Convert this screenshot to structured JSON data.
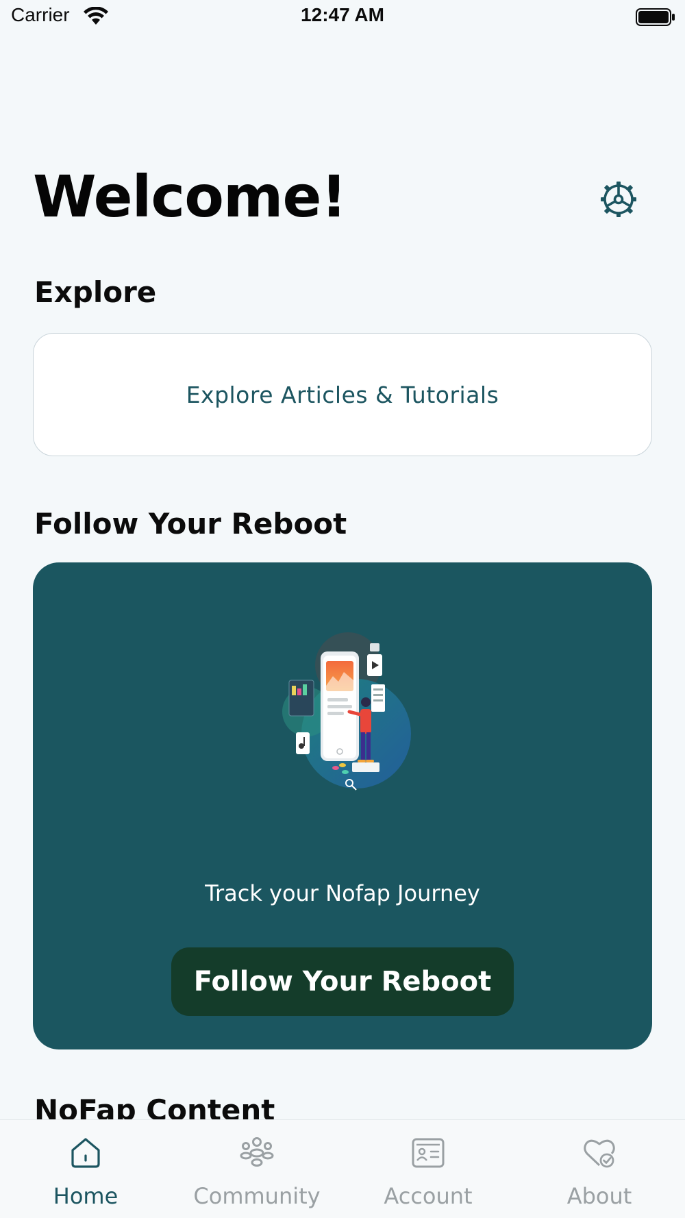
{
  "status_bar": {
    "carrier": "Carrier",
    "time": "12:47 AM"
  },
  "header": {
    "title": "Welcome!",
    "settings_icon": "gear-icon"
  },
  "explore": {
    "title": "Explore",
    "card_label": "Explore Articles & Tutorials"
  },
  "reboot": {
    "title": "Follow Your Reboot",
    "subtitle": "Track your Nofap Journey",
    "button_label": "Follow Your Reboot"
  },
  "content": {
    "title": "NoFap Content"
  },
  "tabs": [
    {
      "label": "Home",
      "icon": "home-icon",
      "active": true
    },
    {
      "label": "Community",
      "icon": "community-icon",
      "active": false
    },
    {
      "label": "Account",
      "icon": "account-card-icon",
      "active": false
    },
    {
      "label": "About",
      "icon": "heart-check-icon",
      "active": false
    }
  ],
  "colors": {
    "background": "#f4f8fa",
    "accent": "#1c5560",
    "card_teal": "#1b5660",
    "button_dark": "#143c2a",
    "tab_inactive": "#9aa0a3"
  }
}
